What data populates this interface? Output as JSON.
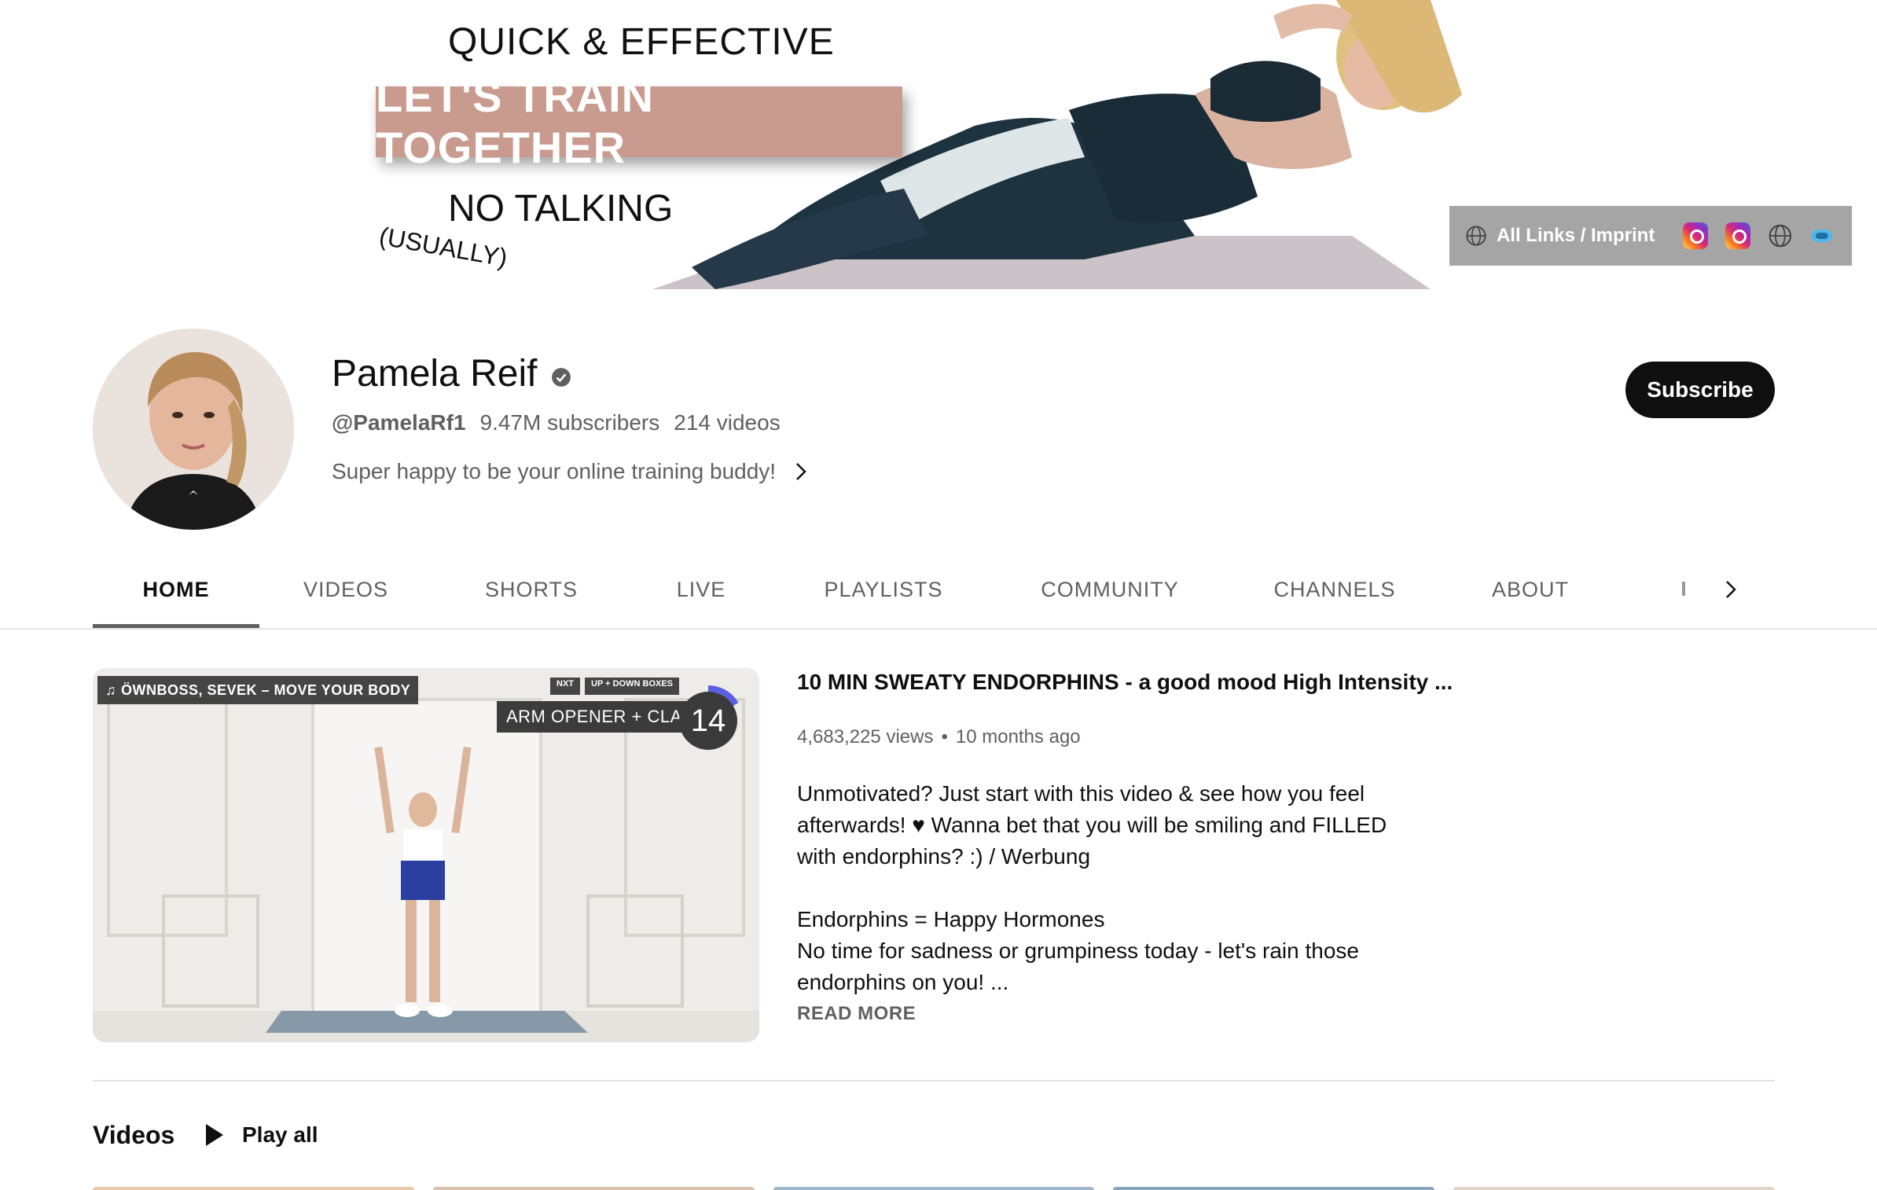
{
  "banner": {
    "line1": "QUICK & EFFECTIVE",
    "line2": "LET'S TRAIN TOGETHER",
    "line3": "NO TALKING",
    "line4": "(USUALLY)",
    "links_label": "All Links / Imprint",
    "social_icons": [
      "instagram-icon",
      "instagram-icon",
      "globe-icon",
      "link-icon"
    ]
  },
  "channel": {
    "name": "Pamela Reif",
    "handle": "@PamelaRf1",
    "subscribers": "9.47M subscribers",
    "videos": "214 videos",
    "description": "Super happy to be your online training buddy!",
    "subscribe_label": "Subscribe"
  },
  "tabs": [
    {
      "label": "HOME",
      "active": true
    },
    {
      "label": "VIDEOS",
      "active": false
    },
    {
      "label": "SHORTS",
      "active": false
    },
    {
      "label": "LIVE",
      "active": false
    },
    {
      "label": "PLAYLISTS",
      "active": false
    },
    {
      "label": "COMMUNITY",
      "active": false
    },
    {
      "label": "CHANNELS",
      "active": false
    },
    {
      "label": "ABOUT",
      "active": false
    }
  ],
  "featured": {
    "thumb_music": "ÖWNBOSS, SEVEK – MOVE YOUR BODY",
    "thumb_next_1": "NXT",
    "thumb_next_2": "UP + DOWN BOXES",
    "thumb_move": "ARM OPENER + CLAP",
    "thumb_counter": "14",
    "title": "10 MIN SWEATY ENDORPHINS - a good mood High Intensity ...",
    "views": "4,683,225 views",
    "separator": "•",
    "age": "10 months ago",
    "desc_p1": "Unmotivated? Just start with this video & see how you feel afterwards! ♥ Wanna bet that you will be smiling and FILLED with endorphins? :) / Werbung",
    "desc_p2a": "Endorphins = Happy Hormones",
    "desc_p2b": "No time for sadness or grumpiness today - let's rain those endorphins on you! ...",
    "read_more": "READ MORE"
  },
  "shelf": {
    "title": "Videos",
    "play_all": "Play all"
  },
  "colors": {
    "accent_pill": "#c99a8e",
    "subscribe_bg": "#0f0f0f",
    "secondary_text": "#606060"
  }
}
